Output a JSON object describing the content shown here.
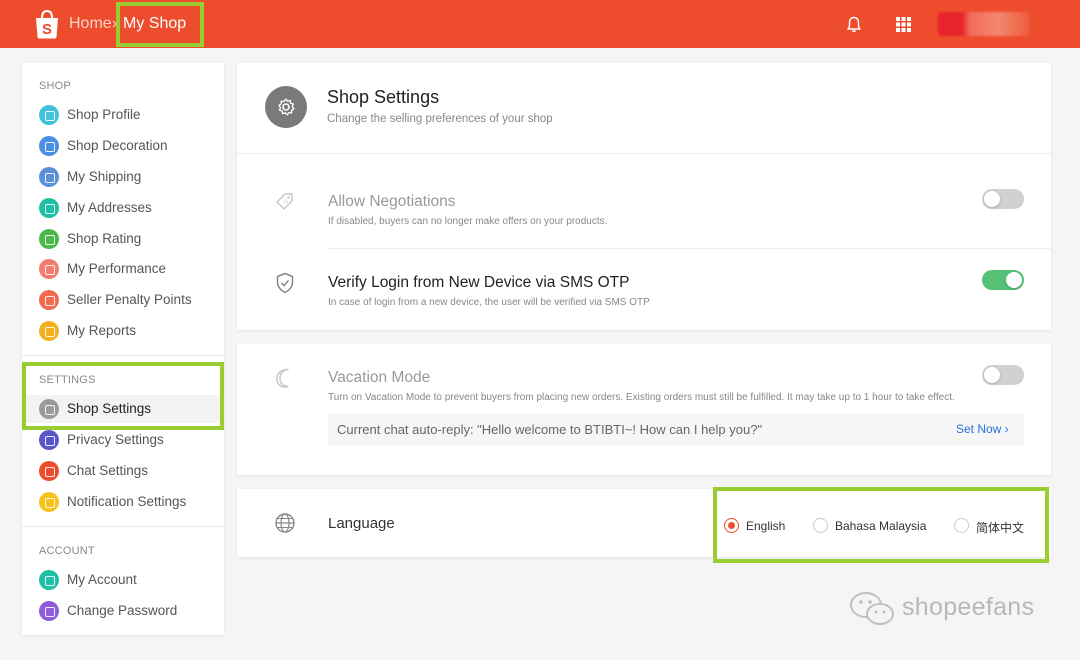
{
  "header": {
    "breadcrumb_home": "Home",
    "breadcrumb_separator": "›",
    "breadcrumb_current": "My Shop",
    "brand_color": "#ee4d2d",
    "icons": [
      "shopee-logo-icon",
      "bell-icon",
      "apps-grid-icon"
    ]
  },
  "sidebar": {
    "sections": [
      {
        "title": "SHOP",
        "items": [
          {
            "label": "Shop Profile",
            "icon": "shop-profile-icon",
            "color": "#42c1dd"
          },
          {
            "label": "Shop Decoration",
            "icon": "paint-roller-icon",
            "color": "#4a90e2"
          },
          {
            "label": "My Shipping",
            "icon": "truck-icon",
            "color": "#5b8fd6"
          },
          {
            "label": "My Addresses",
            "icon": "location-pin-icon",
            "color": "#1ebfa5"
          },
          {
            "label": "Shop Rating",
            "icon": "star-icon",
            "color": "#4cb84c"
          },
          {
            "label": "My Performance",
            "icon": "chart-icon",
            "color": "#f27c6f"
          },
          {
            "label": "Seller Penalty Points",
            "icon": "lightning-icon",
            "color": "#f26a4f"
          },
          {
            "label": "My Reports",
            "icon": "report-icon",
            "color": "#f5b020"
          }
        ]
      },
      {
        "title": "SETTINGS",
        "items": [
          {
            "label": "Shop Settings",
            "icon": "gear-icon",
            "color": "#9a9a9a",
            "active": true
          },
          {
            "label": "Privacy Settings",
            "icon": "lock-icon",
            "color": "#5856c8"
          },
          {
            "label": "Chat Settings",
            "icon": "chat-icon",
            "color": "#ee4d2d"
          },
          {
            "label": "Notification Settings",
            "icon": "notification-icon",
            "color": "#f5c31a"
          }
        ]
      },
      {
        "title": "ACCOUNT",
        "items": [
          {
            "label": "My Account",
            "icon": "id-card-icon",
            "color": "#1ebfa5"
          },
          {
            "label": "Change Password",
            "icon": "key-icon",
            "color": "#8e5cd9"
          }
        ]
      }
    ]
  },
  "main": {
    "title": "Shop Settings",
    "subtitle": "Change the selling preferences of your shop",
    "settings": {
      "negotiations": {
        "title": "Allow Negotiations",
        "desc": "If disabled, buyers can no longer make offers on your products.",
        "enabled": false
      },
      "sms_otp": {
        "title": "Verify Login from New Device via SMS OTP",
        "desc": "In case of login from a new device, the user will be verified via SMS OTP",
        "enabled": true
      },
      "vacation": {
        "title": "Vacation Mode",
        "desc": "Turn on Vacation Mode to prevent buyers from placing new orders. Existing orders must still be fulfilled. It may take up to 1 hour to take effect.",
        "enabled": false,
        "autoreply": "Current chat auto-reply: \"Hello welcome to BTIBTI~! How can I help you?\"",
        "set_now": "Set Now ›"
      }
    },
    "language": {
      "label": "Language",
      "options": [
        "English",
        "Bahasa Malaysia",
        "简体中文"
      ],
      "selected": "English"
    }
  },
  "watermark": "shopeefans"
}
